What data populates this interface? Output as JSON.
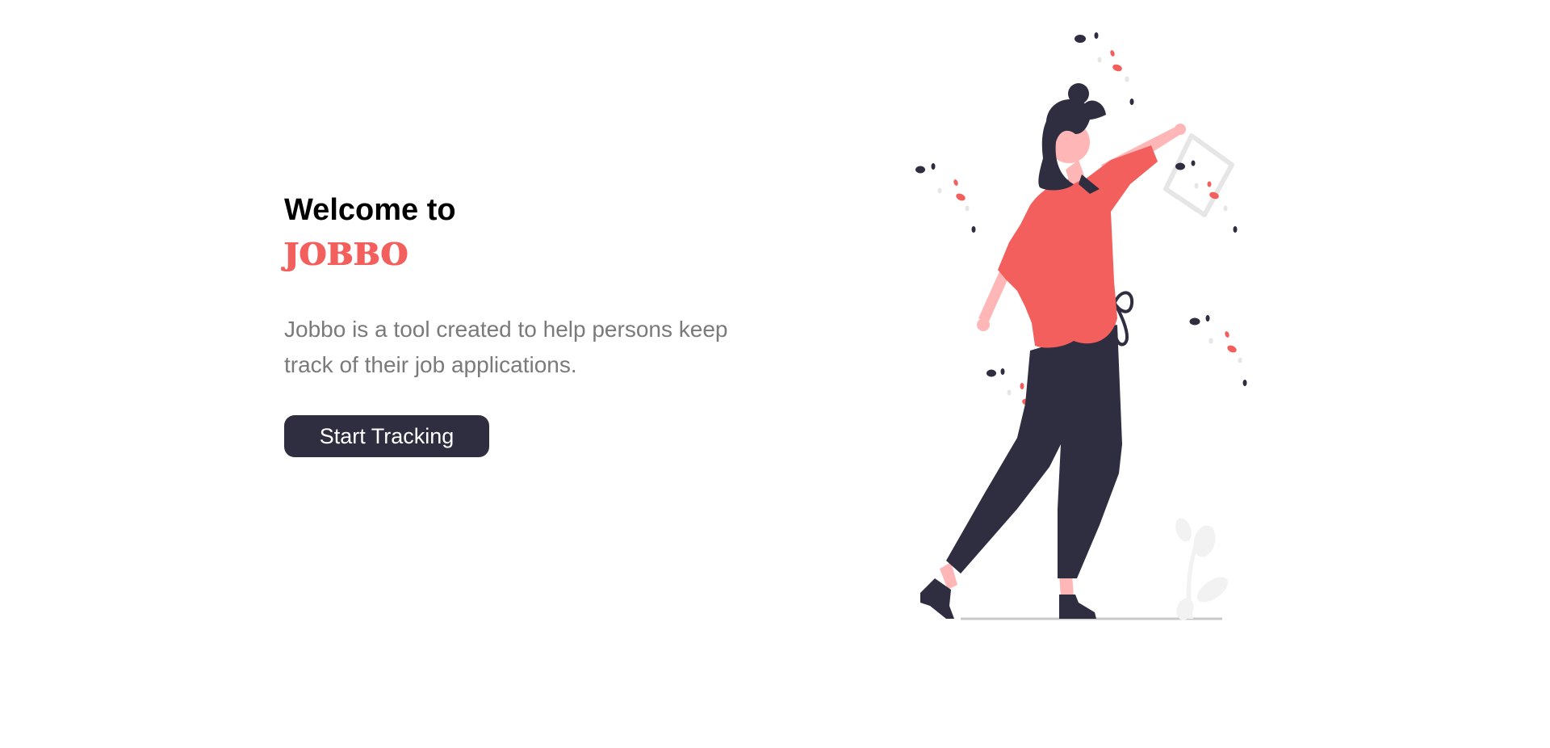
{
  "hero": {
    "heading": "Welcome to",
    "brand_name": "JOBBO",
    "description": "Jobbo is a tool created to help persons keep track of their job applications.",
    "cta_label": "Start Tracking"
  },
  "colors": {
    "accent": "#f25f5c",
    "dark": "#2f2e41",
    "body_text": "#7a7a7a",
    "skin": "#ffb6b6"
  },
  "illustration": {
    "icon": "woman-dancing-with-bag-illustration"
  }
}
